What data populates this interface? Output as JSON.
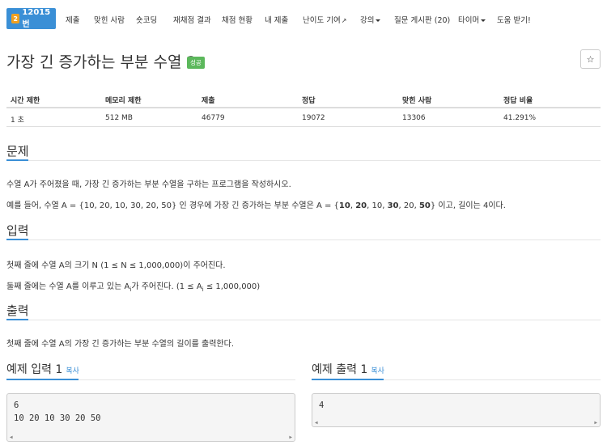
{
  "nav": {
    "problem_id": "12015번",
    "badge": "2",
    "items": [
      "제출",
      "맞힌 사람",
      "숏코딩",
      "재채점 결과",
      "채점 현황",
      "내 제출",
      "난이도 기여",
      "강의",
      "질문 게시판 (20)",
      "타이머",
      "도움 받기!"
    ]
  },
  "title": "가장 긴 증가하는 부분 수열 2",
  "status_badge": "성공",
  "stats": {
    "headers": [
      "시간 제한",
      "메모리 제한",
      "제출",
      "정답",
      "맞힌 사람",
      "정답 비율"
    ],
    "values": [
      "1 초",
      "512 MB",
      "46779",
      "19072",
      "13306",
      "41.291%"
    ]
  },
  "sections": {
    "problem": {
      "title": "문제",
      "p1": "수열 A가 주어졌을 때, 가장 긴 증가하는 부분 수열을 구하는 프로그램을 작성하시오.",
      "p2_prefix": "예를 들어, 수열 A = {10, 20, 10, 30, 20, 50} 인 경우에 가장 긴 증가하는 부분 수열은 A = {",
      "p2_b1": "10",
      "p2_s1": ", ",
      "p2_b2": "20",
      "p2_s2": ", 10, ",
      "p2_b3": "30",
      "p2_s3": ", 20, ",
      "p2_b4": "50",
      "p2_suffix": "} 이고, 길이는 4이다."
    },
    "input": {
      "title": "입력",
      "p1": "첫째 줄에 수열 A의 크기 N (1 ≤ N ≤ 1,000,000)이 주어진다.",
      "p2_prefix": "둘째 줄에는 수열 A를 이루고 있는 A",
      "p2_sub1": "i",
      "p2_mid": "가 주어진다. (1 ≤ A",
      "p2_sub2": "i",
      "p2_suffix": " ≤ 1,000,000)"
    },
    "output": {
      "title": "출력",
      "p1": "첫째 줄에 수열 A의 가장 긴 증가하는 부분 수열의 길이를 출력한다."
    }
  },
  "examples": {
    "copy_label": "복사",
    "input_title": "예제 입력 1",
    "input_lines": [
      "6",
      "10 20 10 30 20 50"
    ],
    "output_title": "예제 출력 1",
    "output_lines": [
      "4"
    ]
  },
  "colors": {
    "accent": "#3a8fd6",
    "success": "#5cb85c",
    "badge": "#f0a020"
  },
  "icons": {
    "star": "star-icon",
    "external": "external-link-icon"
  }
}
